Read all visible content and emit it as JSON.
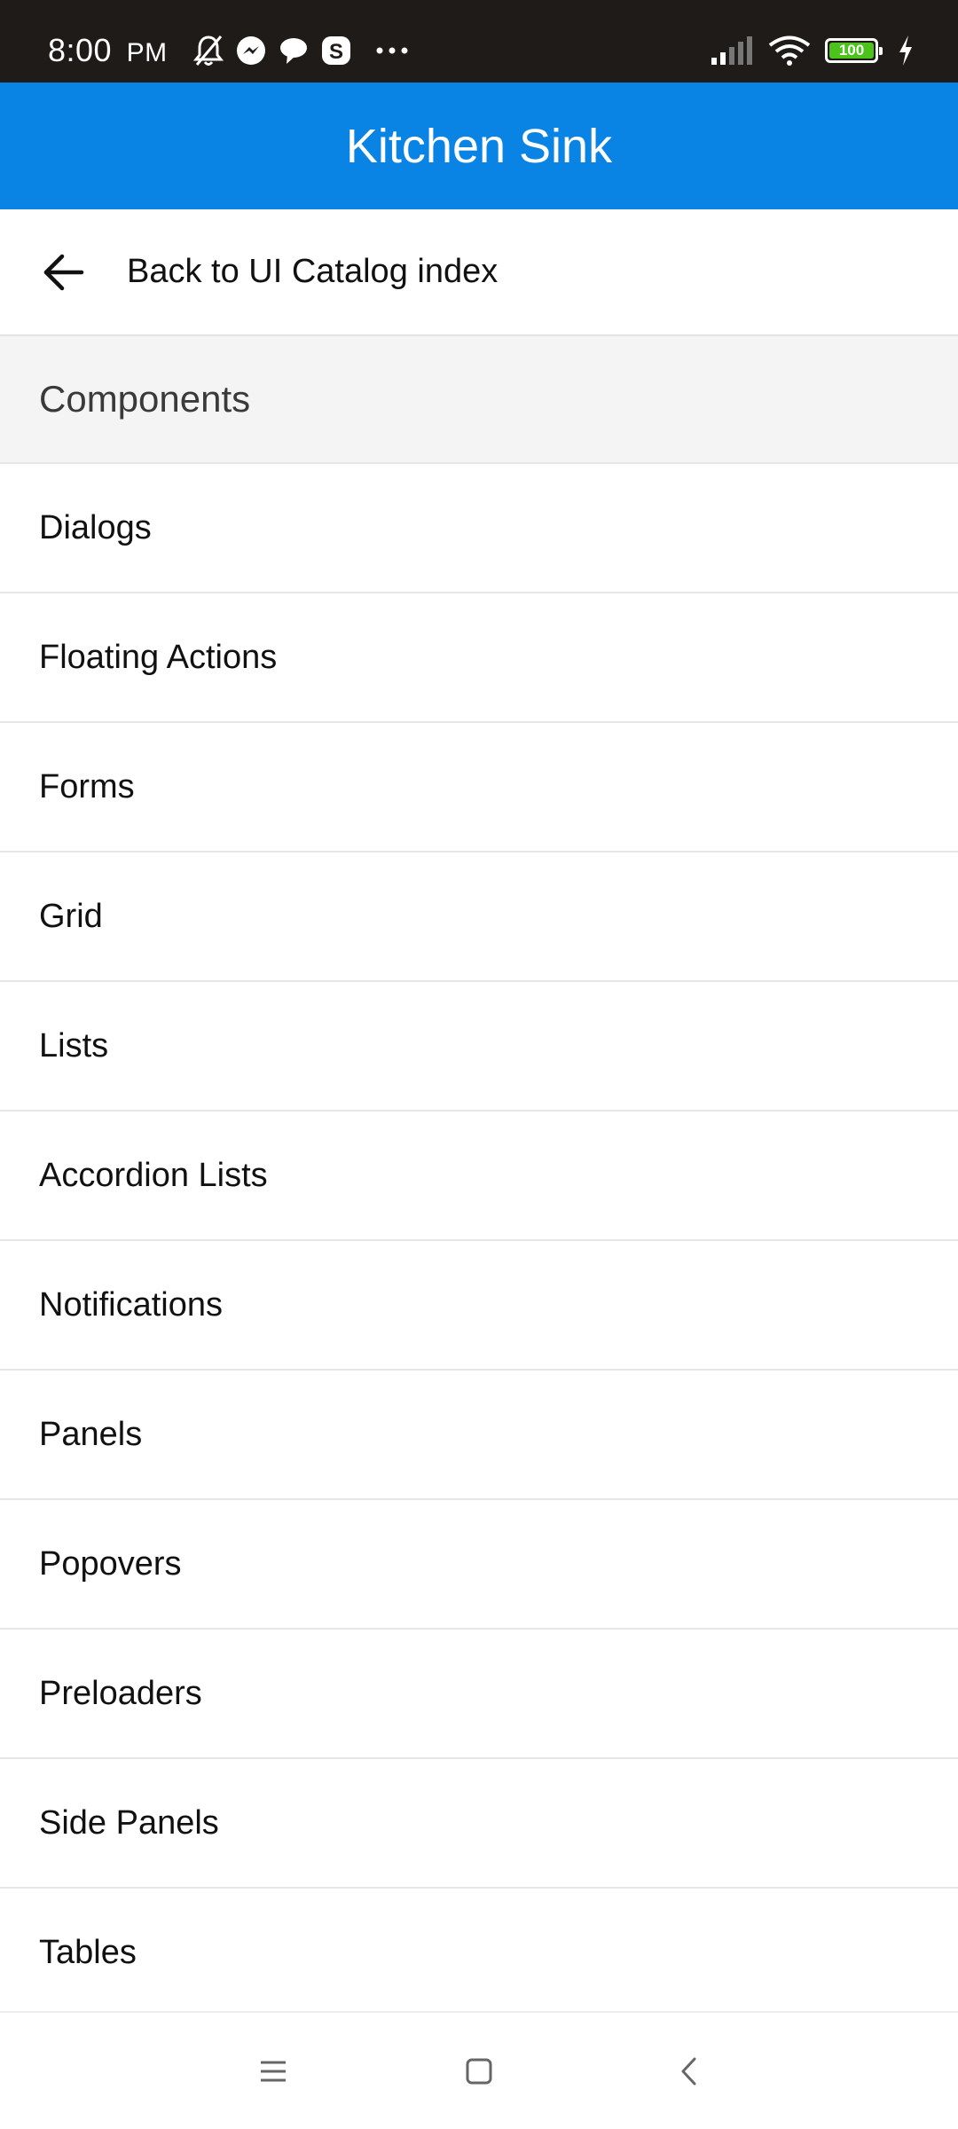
{
  "status_bar": {
    "time": "8:00",
    "am_pm": "PM",
    "left_icons": [
      "mute-bell-icon",
      "messenger-icon",
      "chat-bubble-icon",
      "skype-icon",
      "more-dots-icon"
    ],
    "right_icons": [
      "signal-icon",
      "wifi-icon",
      "battery-icon",
      "charging-icon"
    ],
    "battery_level": "100",
    "battery_color": "#4cc21c"
  },
  "app_bar": {
    "title": "Kitchen Sink",
    "background": "#0a84e4"
  },
  "back_link": {
    "label": "Back to UI Catalog index"
  },
  "section": {
    "title": "Components"
  },
  "list": {
    "items": [
      "Dialogs",
      "Floating Actions",
      "Forms",
      "Grid",
      "Lists",
      "Accordion Lists",
      "Notifications",
      "Panels",
      "Popovers",
      "Preloaders",
      "Side Panels",
      "Tables"
    ]
  },
  "nav_bar": {
    "buttons": [
      "menu-icon",
      "home-square-icon",
      "back-chevron-icon"
    ]
  }
}
